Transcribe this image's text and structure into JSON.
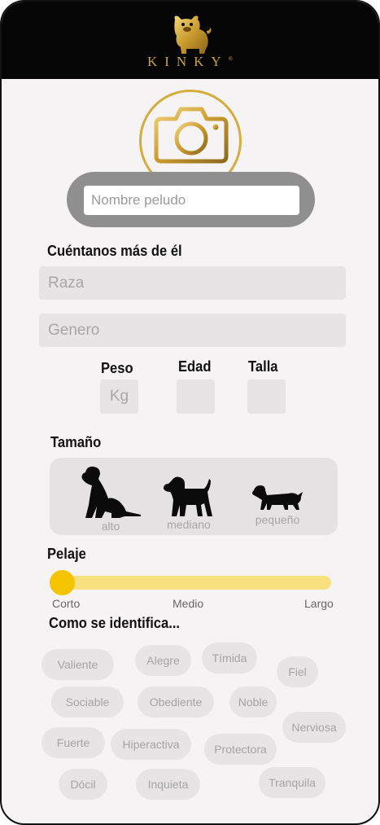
{
  "brand": {
    "name": "KINKY",
    "trademark": "®",
    "accent": "#c9a24a"
  },
  "photo": {
    "icon": "camera-icon"
  },
  "name_input": {
    "placeholder": "Nombre peludo",
    "value": ""
  },
  "details": {
    "title": "Cuéntanos más de él",
    "breed_placeholder": "Raza",
    "gender_placeholder": "Genero"
  },
  "measures": {
    "weight_label": "Peso",
    "weight_placeholder": "Kg",
    "age_label": "Edad",
    "size_label": "Talla"
  },
  "size": {
    "title": "Tamaño",
    "options": [
      {
        "label": "alto",
        "icon": "tall-dog-icon"
      },
      {
        "label": "mediano",
        "icon": "medium-dog-icon"
      },
      {
        "label": "pequeño",
        "icon": "small-dog-icon"
      }
    ]
  },
  "coat": {
    "title": "Pelaje",
    "labels": [
      "Corto",
      "Medio",
      "Largo"
    ],
    "selected": "Corto",
    "value_fraction": 0,
    "track_color": "#f8e07e",
    "thumb_color": "#f5c400"
  },
  "traits": {
    "title": "Como se identifica...",
    "chips": [
      "Valiente",
      "Alegre",
      "Tímida",
      "Fiel",
      "Sociable",
      "Obediente",
      "Noble",
      "Nerviosa",
      "Fuerte",
      "Hiperactiva",
      "Protectora",
      "Dócil",
      "Inquieta",
      "Tranquila"
    ]
  }
}
